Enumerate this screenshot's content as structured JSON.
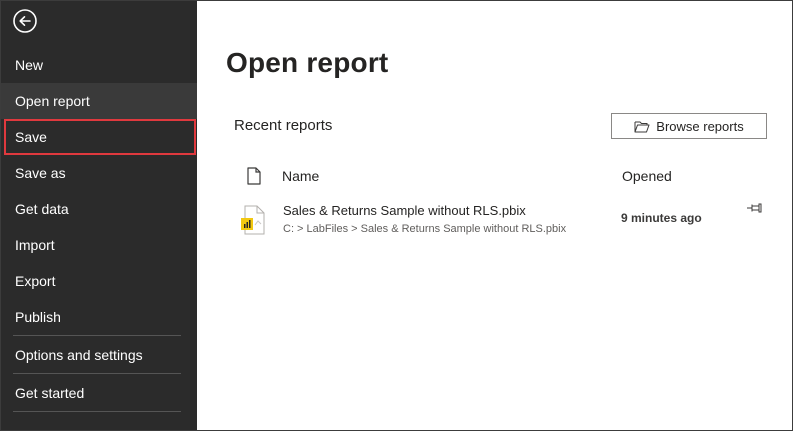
{
  "sidebar": {
    "items": [
      {
        "label": "New"
      },
      {
        "label": "Open report"
      },
      {
        "label": "Save"
      },
      {
        "label": "Save as"
      },
      {
        "label": "Get data"
      },
      {
        "label": "Import"
      },
      {
        "label": "Export"
      },
      {
        "label": "Publish"
      },
      {
        "label": "Options and settings"
      },
      {
        "label": "Get started"
      }
    ]
  },
  "main": {
    "title": "Open report",
    "section_title": "Recent reports",
    "browse_label": "Browse reports",
    "columns": {
      "name": "Name",
      "opened": "Opened"
    },
    "reports": [
      {
        "name": "Sales & Returns Sample without RLS.pbix",
        "path": "C: > LabFiles > Sales & Returns Sample without RLS.pbix",
        "opened": "9 minutes ago"
      }
    ]
  },
  "colors": {
    "sidebar_bg": "#2b2b2b",
    "active_item_bg": "#3a3a3a",
    "highlight_border": "#e0393e",
    "file_icon_accent": "#f2c811"
  }
}
